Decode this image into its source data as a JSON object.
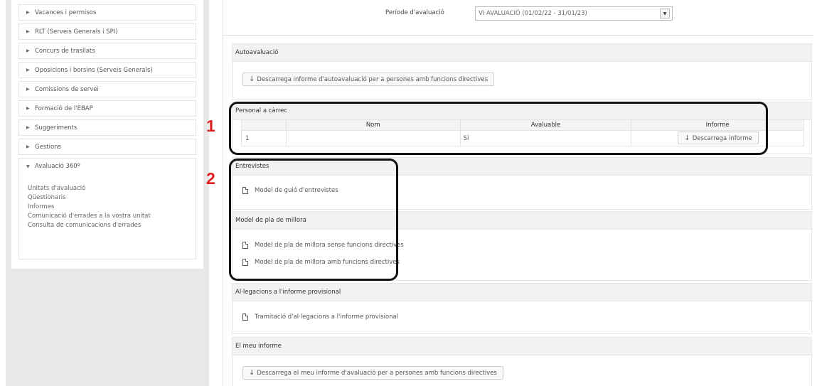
{
  "sidebar": {
    "items": [
      {
        "label": "Vacances i permisos"
      },
      {
        "label": "RLT (Serveis Generals i SPI)"
      },
      {
        "label": "Concurs de trasllats"
      },
      {
        "label": "Oposicions i borsins (Serveis Generals)"
      },
      {
        "label": "Comissions de servei"
      },
      {
        "label": "Formació de l'EBAP"
      },
      {
        "label": "Suggeriments"
      },
      {
        "label": "Gestions"
      }
    ],
    "open_item": {
      "label": "Avaluació 360º"
    },
    "sub_items": [
      {
        "label": "Unitats d'avaluació"
      },
      {
        "label": "Qüestionaris"
      },
      {
        "label": "Informes"
      },
      {
        "label": "Comunicació d'errades a la vostra unitat"
      },
      {
        "label": "Consulta de comunicacions d'errades"
      }
    ]
  },
  "annotations": {
    "one": "1",
    "two": "2"
  },
  "period": {
    "label": "Període d'avaluació",
    "selected": "VI AVALUACIÓ (01/02/22 - 31/01/23)"
  },
  "autoavaluacio": {
    "title": "Autoavaluació",
    "button": "Descarrega informe d'autoavaluació per a persones amb funcions directives"
  },
  "personal": {
    "title": "Personal a càrrec",
    "columns": [
      "",
      "Nom",
      "Avaluable",
      "Informe"
    ],
    "rows": [
      {
        "num": "1",
        "nom": "",
        "avaluable": "Sí",
        "informe": "Descarrega informe"
      }
    ]
  },
  "entrevistes": {
    "title": "Entrevistes",
    "links": [
      {
        "label": "Model de guió d'entrevistes"
      }
    ]
  },
  "millora": {
    "title": "Model de pla de millora",
    "links": [
      {
        "label": "Model de pla de millora sense funcions directives"
      },
      {
        "label": "Model de pla de millora amb funcions directives"
      }
    ]
  },
  "allegacions": {
    "title": "Al·legacions a l'informe provisional",
    "links": [
      {
        "label": "Tramitació d'al·legacions a l'informe provisional"
      }
    ]
  },
  "meu_informe": {
    "title": "El meu informe",
    "button": "Descarrega el meu informe d'avaluació per a persones amb funcions directives"
  },
  "icons": {
    "expand": "triangle-right-icon",
    "collapse": "triangle-down-icon",
    "download": "arrow-down-icon",
    "document": "document-icon"
  }
}
